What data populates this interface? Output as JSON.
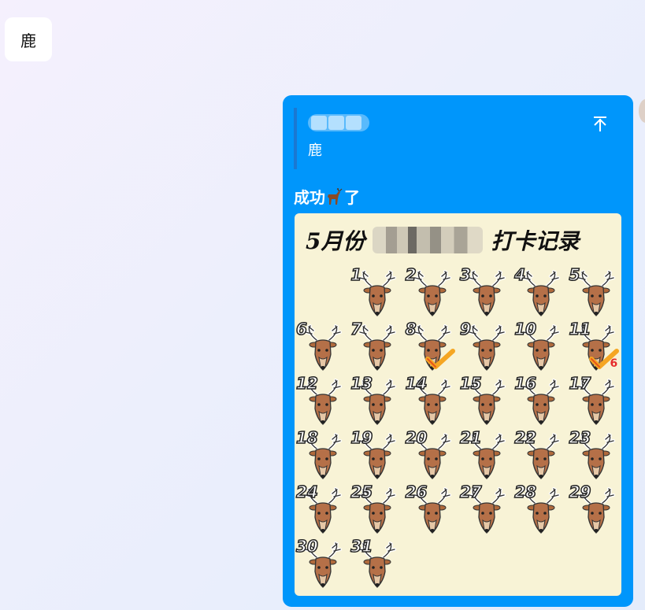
{
  "left_message": {
    "text": "鹿"
  },
  "message": {
    "quote_text": "鹿",
    "caption": "成功",
    "caption_suffix": "了",
    "card": {
      "title_prefix": "5月份",
      "title_suffix": "打卡记录",
      "days": [
        "1",
        "2",
        "3",
        "4",
        "5",
        "6",
        "7",
        "8",
        "9",
        "10",
        "11",
        "12",
        "13",
        "14",
        "15",
        "16",
        "17",
        "18",
        "19",
        "20",
        "21",
        "22",
        "23",
        "24",
        "25",
        "26",
        "27",
        "28",
        "29",
        "30",
        "31"
      ],
      "checked_days": [
        "8",
        "11"
      ],
      "badge_day": "11",
      "badge_text": "6"
    }
  },
  "colors": {
    "bubble": "#0096fb",
    "card_bg": "#f8f3d6",
    "check": "#f5a623",
    "badge": "#e52b2b"
  },
  "icons": {
    "scroll_top": "arrow-up-bar-icon",
    "deer": "deer-head-icon",
    "check": "checkmark-icon"
  }
}
